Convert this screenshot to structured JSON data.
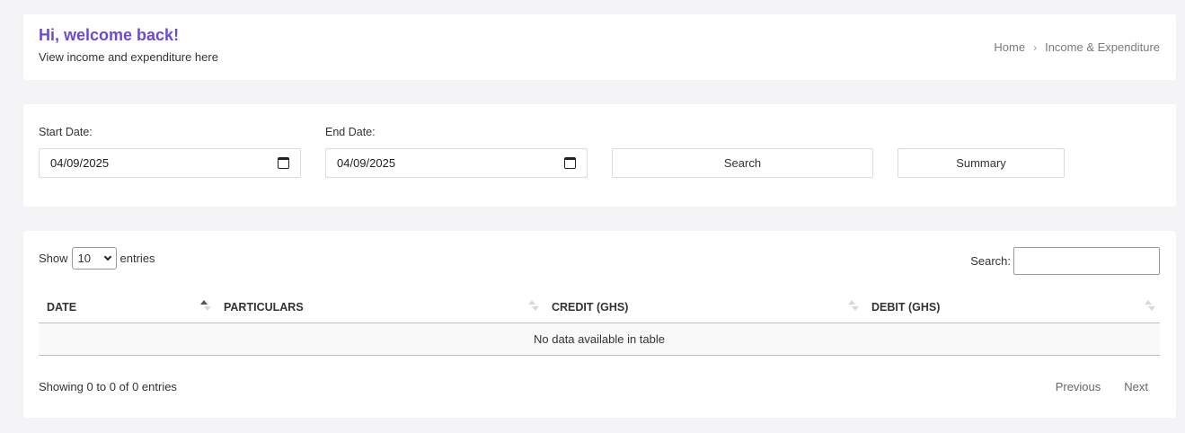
{
  "header": {
    "title": "Hi, welcome back!",
    "subtitle": "View income and expenditure here",
    "breadcrumb": {
      "home": "Home",
      "current": "Income & Expenditure"
    }
  },
  "filter": {
    "start_label": "Start Date:",
    "start_value": "04/09/2025",
    "end_label": "End Date:",
    "end_value": "04/09/2025",
    "search_button": "Search",
    "summary_button": "Summary"
  },
  "table": {
    "show_label": "Show",
    "page_length": "10",
    "entries_label": "entries",
    "search_label": "Search:",
    "search_value": "",
    "columns": [
      "DATE",
      "PARTICULARS",
      "CREDIT (GHS)",
      "DEBIT (GHS)"
    ],
    "empty_message": "No data available in table",
    "info": "Showing 0 to 0 of 0 entries",
    "previous": "Previous",
    "next": "Next"
  },
  "colors": {
    "accent": "#6c4ad6",
    "background": "#f4f4f7"
  }
}
